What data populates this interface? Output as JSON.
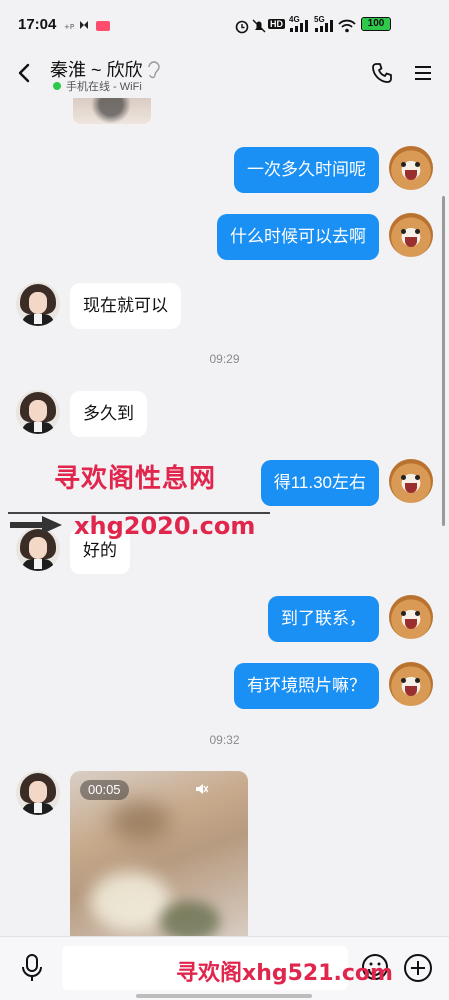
{
  "status_bar": {
    "time": "17:04",
    "battery": "100",
    "network_1": "4G",
    "network_2": "5G",
    "hd": "HD"
  },
  "header": {
    "contact_name": "秦淮 ~ 欣欣",
    "online_status": "手机在线 - WiFi"
  },
  "messages": [
    {
      "side": "out",
      "text": "一次多久时间呢"
    },
    {
      "side": "out",
      "text": "什么时候可以去啊"
    },
    {
      "side": "in",
      "text": "现在就可以"
    },
    {
      "side": "in",
      "text": "多久到"
    },
    {
      "side": "out",
      "text": "得11.30左右"
    },
    {
      "side": "in",
      "text": "好的"
    },
    {
      "side": "out",
      "text": "到了联系，"
    },
    {
      "side": "out",
      "text": "有环境照片嘛？"
    }
  ],
  "timestamps": [
    "09:29",
    "09:32"
  ],
  "video": {
    "duration": "00:05"
  },
  "watermarks": {
    "top": "寻欢阁性息网",
    "url": "xhg2020.com",
    "bottom": "寻欢阁xhg521.com"
  },
  "input": {
    "placeholder": ""
  },
  "colors": {
    "outgoing_bubble": "#1a8ff4",
    "incoming_bubble": "#ffffff",
    "background": "#f2f2f4",
    "watermark": "#e0264c",
    "online_dot": "#2ec84a"
  },
  "icons": [
    "back-icon",
    "ear-icon",
    "phone-icon",
    "menu-icon",
    "mute-icon",
    "mic-icon",
    "emoji-icon",
    "plus-icon",
    "alarm-icon",
    "mute-bell-icon",
    "signal-icon",
    "wifi-icon",
    "battery-icon"
  ]
}
